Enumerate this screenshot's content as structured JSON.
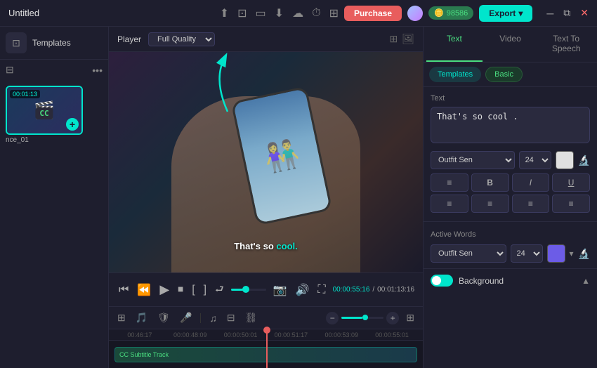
{
  "titleBar": {
    "title": "Untitled",
    "purchaseLabel": "Purchase",
    "credits": "98586",
    "exportLabel": "Export",
    "icons": [
      "share",
      "device",
      "monitor",
      "save",
      "cloud",
      "timer",
      "grid"
    ]
  },
  "player": {
    "label": "Player",
    "quality": "Full Quality",
    "timeCurrentLabel": "00:00:55:16",
    "timeTotalLabel": "00:01:13:16",
    "caption": "That's so cool.",
    "captionCoolWord": "cool"
  },
  "rightPanel": {
    "tabs": [
      {
        "label": "Text",
        "active": true
      },
      {
        "label": "Video",
        "active": false
      },
      {
        "label": "Text To Speech",
        "active": false
      }
    ],
    "subtabs": [
      {
        "label": "Templates",
        "active": true
      },
      {
        "label": "Basic",
        "active": false
      }
    ],
    "textSection": {
      "label": "Text",
      "value": "That's so cool .",
      "fontFamily": "Outfit Sen",
      "fontSize": "24",
      "formatButtons": [
        "≡≡",
        "B",
        "I",
        "U"
      ],
      "alignButtons": [
        "≡",
        "≡",
        "≡",
        "≡"
      ]
    },
    "activeWords": {
      "label": "Active Words",
      "fontFamily": "Outfit Sen",
      "fontSize": "24"
    },
    "background": {
      "label": "Background",
      "enabled": true
    }
  },
  "sidebar": {
    "title": "Templates",
    "mediaItems": [
      {
        "label": "nce_01",
        "time": "00:01:13"
      }
    ]
  },
  "timeline": {
    "rulers": [
      "00:46:17",
      "00:00:48:09",
      "00:00:50:01",
      "00:00:51:17",
      "00:00:53:09",
      "00:00:55:01"
    ]
  }
}
